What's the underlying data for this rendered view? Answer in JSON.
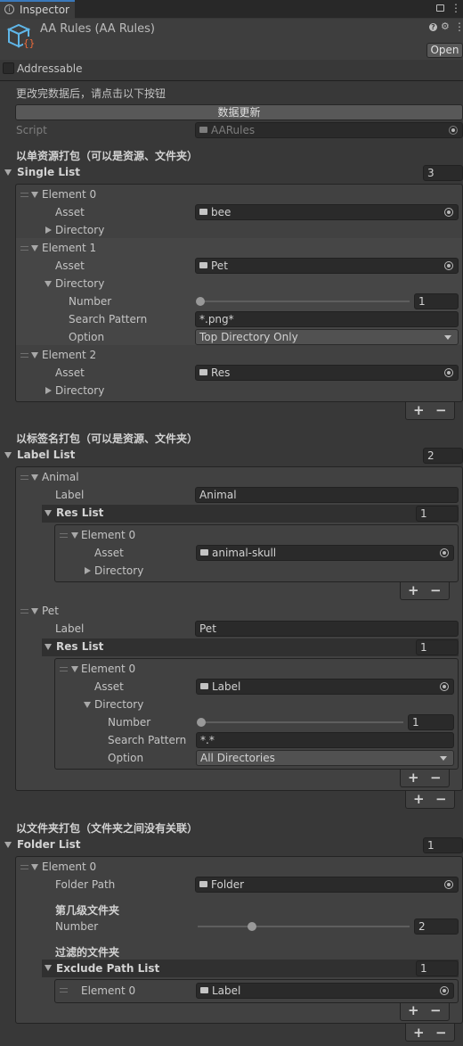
{
  "tab": {
    "title": "Inspector"
  },
  "header": {
    "title": "AA Rules (AA Rules)",
    "open_label": "Open"
  },
  "addressable": {
    "label": "Addressable",
    "checked": false
  },
  "notice": {
    "text": "更改完数据后，请点击以下按钮",
    "button": "数据更新"
  },
  "script": {
    "label": "Script",
    "value": "AARules"
  },
  "single": {
    "section_title": "以单资源打包（可以是资源、文件夹）",
    "list_label": "Single List",
    "count": "3",
    "elements": [
      {
        "title": "Element 0",
        "asset_label": "Asset",
        "asset": "bee",
        "dir_label": "Directory"
      },
      {
        "title": "Element 1",
        "asset_label": "Asset",
        "asset": "Pet",
        "dir_label": "Directory",
        "number_label": "Number",
        "number": "1",
        "pattern_label": "Search Pattern",
        "pattern": "*.png*",
        "option_label": "Option",
        "option": "Top Directory Only"
      },
      {
        "title": "Element 2",
        "asset_label": "Asset",
        "asset": "Res",
        "dir_label": "Directory"
      }
    ]
  },
  "label": {
    "section_title": "以标签名打包（可以是资源、文件夹）",
    "list_label": "Label List",
    "count": "2",
    "groups": [
      {
        "title": "Animal",
        "label_label": "Label",
        "label": "Animal",
        "res_label": "Res List",
        "res_count": "1",
        "element": {
          "title": "Element 0",
          "asset_label": "Asset",
          "asset": "animal-skull",
          "dir_label": "Directory"
        }
      },
      {
        "title": "Pet",
        "label_label": "Label",
        "label": "Pet",
        "res_label": "Res List",
        "res_count": "1",
        "element": {
          "title": "Element 0",
          "asset_label": "Asset",
          "asset": "Label",
          "dir_label": "Directory",
          "number_label": "Number",
          "number": "1",
          "pattern_label": "Search Pattern",
          "pattern": "*.*",
          "option_label": "Option",
          "option": "All Directories"
        }
      }
    ]
  },
  "folder": {
    "section_title": "以文件夹打包（文件夹之间没有关联）",
    "list_label": "Folder List",
    "count": "1",
    "element": {
      "title": "Element 0",
      "path_label": "Folder Path",
      "path": "Folder",
      "level_heading": "第几级文件夹",
      "number_label": "Number",
      "number": "2",
      "filter_heading": "过滤的文件夹",
      "exclude_label": "Exclude Path List",
      "exclude_count": "1",
      "exclude_item_label": "Element 0",
      "exclude_item": "Label"
    }
  },
  "controls": {
    "plus": "+",
    "minus": "−"
  },
  "colors": {
    "background": "#383838",
    "field": "#2a2a2a",
    "text": "#c4c4c4"
  }
}
